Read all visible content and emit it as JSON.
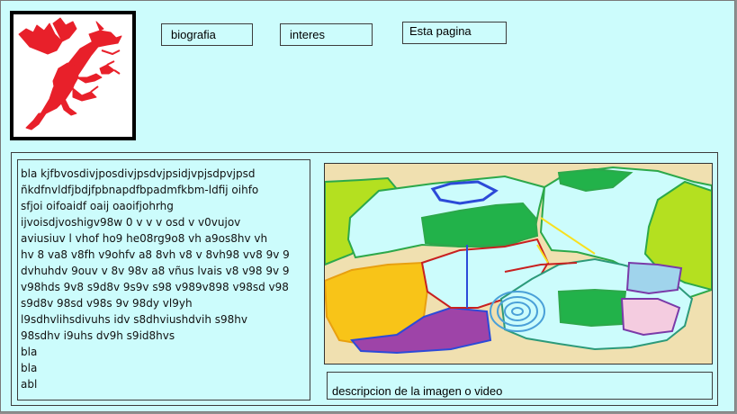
{
  "nav": {
    "biografia": "biografia",
    "intereses": "interes",
    "esta_pagina": "Esta pagina"
  },
  "logo": {
    "icon": "red-dragon-drawing",
    "color": "#e8202a"
  },
  "text_block": {
    "lines": [
      "bla kjfbvosdivjposdivjpsdvjpsidjvpjsdpvjpsd",
      "ñkdfnvldfjbdjfpbnapdfbpadmfkbm-ldfij oihfo",
      "sfjoi oifoaidf oaij oaoifjohrhg",
      "ijvoisdjvoshigv98w 0 v v v osd v v0vujov",
      "aviusiuv l vhof ho9 he08rg9o8 vh a9os8hv vh",
      "hv 8 va8 v8fh v9ohfv a8 8vh  v8 v 8vh98 vv8 9v 9",
      "dvhuhdv 9ouv v 8v 98v a8 vñus lvais v8 v98 9v 9",
      "v98hds 9v8 s9d8v 9s9v s98 v989v898 v98sd v98",
      "s9d8v 98sd v98s 9v 98dy vl9yh",
      "l9sdhvlihsdivuhs idv s8dhviushdvih s98hv",
      "98sdhv i9uhs dv9h s9id8hvs",
      "bla",
      "bla",
      "abl"
    ]
  },
  "media": {
    "icon": "abstract-painting-image",
    "caption": "descripcion de la imagen o video"
  }
}
